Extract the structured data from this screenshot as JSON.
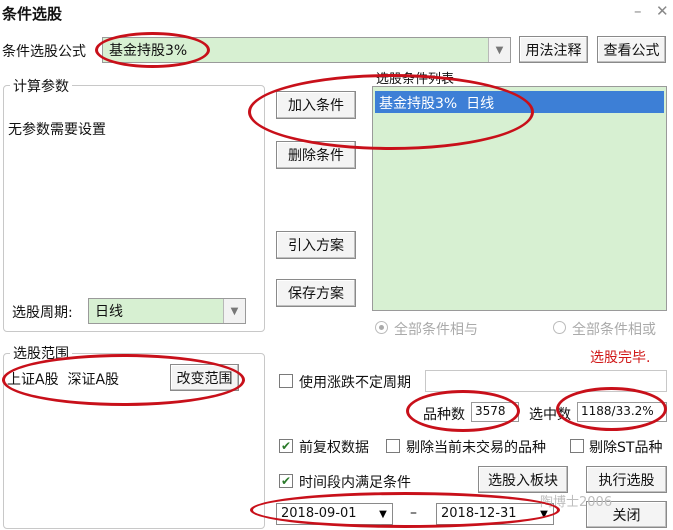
{
  "window": {
    "title": "条件选股",
    "minimize": "–",
    "close": "✕"
  },
  "formula": {
    "label": "条件选股公式",
    "value": "基金持股3%",
    "usage_btn": "用法注释",
    "view_btn": "查看公式"
  },
  "params": {
    "legend": "计算参数",
    "text": "无参数需要设置",
    "period_label": "选股周期:",
    "period_value": "日线"
  },
  "buttons": {
    "add": "加入条件",
    "delete": "删除条件",
    "import": "引入方案",
    "save": "保存方案",
    "change_range": "改变范围",
    "to_block": "选股入板块",
    "execute": "执行选股",
    "close": "关闭"
  },
  "conditions": {
    "legend": "选股条件列表",
    "items": [
      "基金持股3%  日线"
    ],
    "all_and": "全部条件相与",
    "all_or": "全部条件相或"
  },
  "range": {
    "legend": "选股范围",
    "text": "上证A股  深证A股"
  },
  "status": {
    "done": "选股完毕."
  },
  "options": {
    "irregular_period": "使用涨跌不定周期",
    "count_label": "品种数",
    "count_value": "3578",
    "selected_label": "选中数",
    "selected_value": "1188/33.2%",
    "adjust": "前复权数据",
    "exclude_untraded": "剔除当前未交易的品种",
    "exclude_st": "剔除ST品种",
    "time_range": "时间段内满足条件"
  },
  "dates": {
    "start": "2018-09-01",
    "sep": "–",
    "end": "2018-12-31"
  },
  "watermark": "陶博士2006",
  "colors": {
    "field_green": "#d7f0d2",
    "selected_blue": "#3d7fd6",
    "annotation_red": "#c8101a",
    "status_red": "#d01818"
  }
}
